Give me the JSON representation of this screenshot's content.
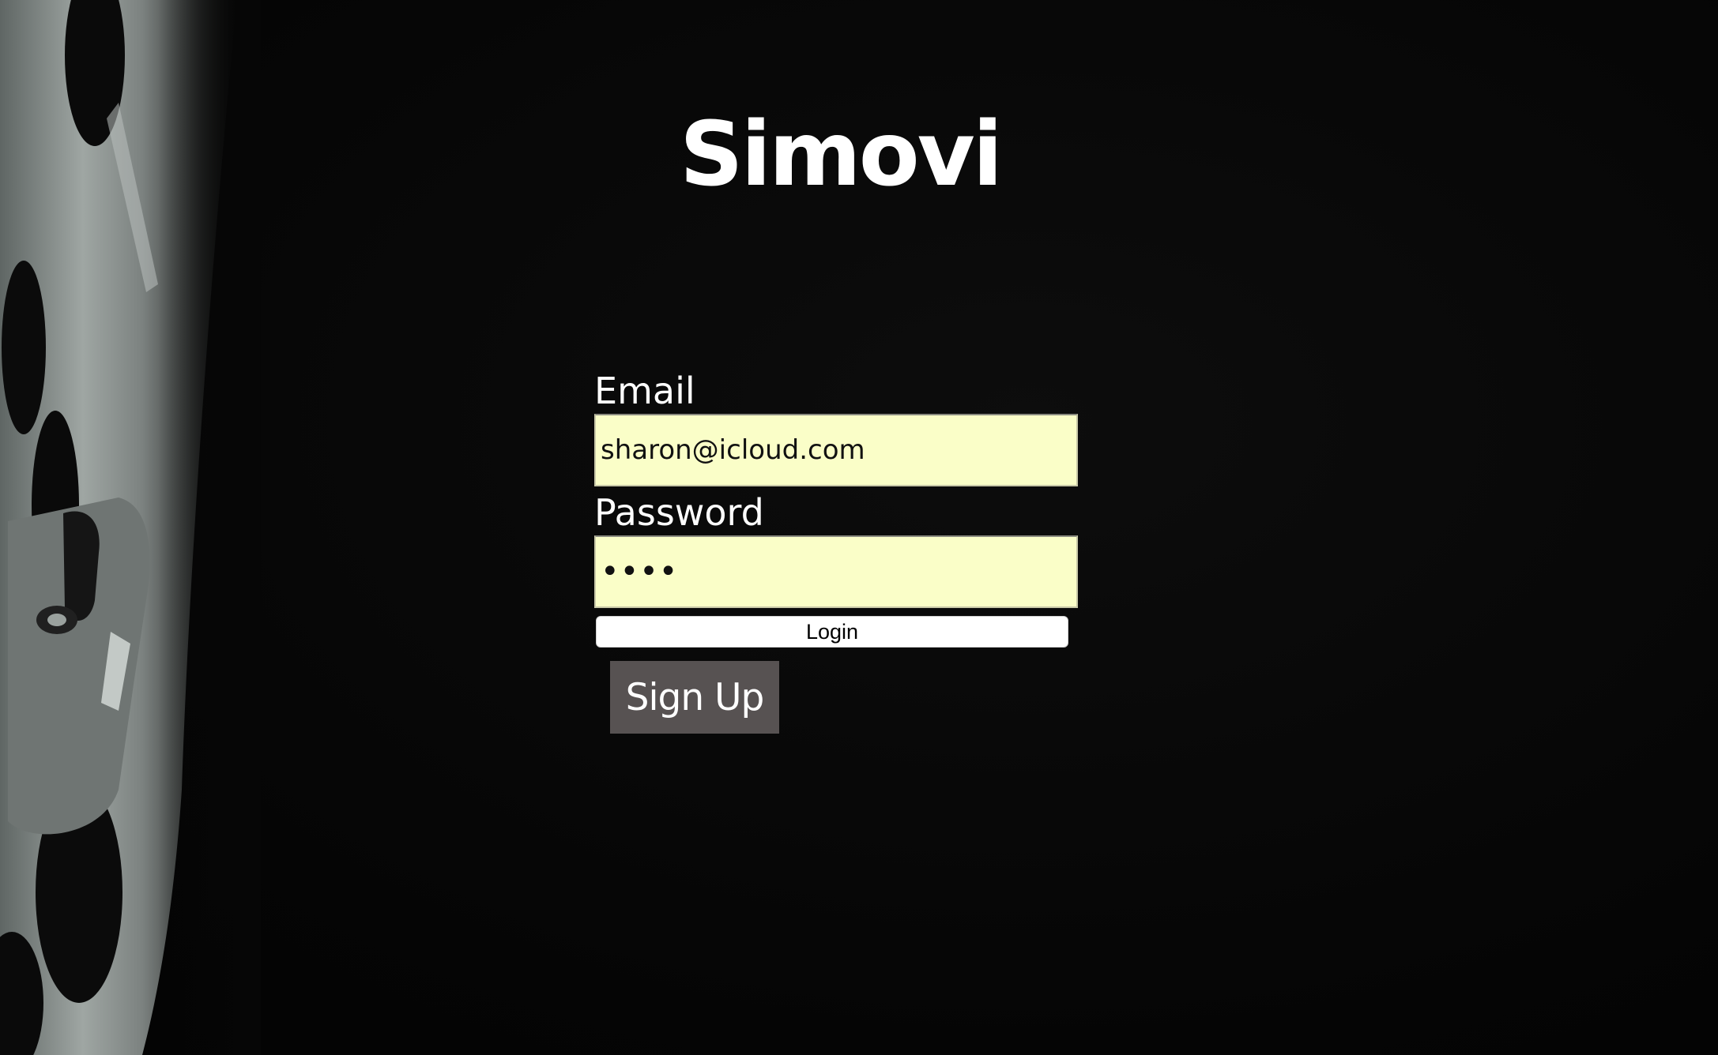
{
  "app": {
    "title": "Simovi"
  },
  "login_form": {
    "email_label": "Email",
    "email_value": "sharon@icloud.com",
    "password_label": "Password",
    "password_value": "abcd",
    "login_label": "Login",
    "signup_label": "Sign Up"
  },
  "colors": {
    "background": "#060606",
    "input_background": "#fafec8",
    "signup_button": "#575252",
    "text": "#ffffff"
  },
  "icons": {
    "background_image": "film-reel-image"
  }
}
